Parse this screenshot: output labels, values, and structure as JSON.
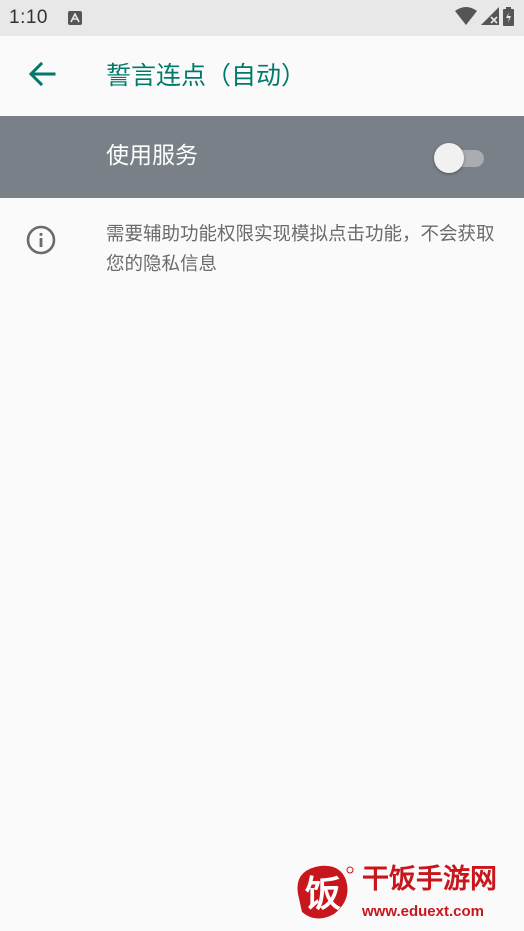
{
  "status_bar": {
    "time": "1:10",
    "icons": [
      "a-notification-icon",
      "wifi-icon",
      "signal-icon",
      "battery-icon"
    ]
  },
  "app_bar": {
    "title": "誓言连点（自动）",
    "back_icon": "arrow-back-icon"
  },
  "service_switch": {
    "label": "使用服务",
    "enabled": false
  },
  "info": {
    "icon": "info-icon",
    "text": "需要辅助功能权限实现模拟点击功能，不会获取您的隐私信息"
  },
  "watermark": {
    "logo_text": "饭",
    "title": "干饭手游网",
    "url": "www.eduext.com"
  },
  "colors": {
    "accent": "#00796b",
    "switch_bar": "#7a8087",
    "watermark": "#c8161d"
  }
}
